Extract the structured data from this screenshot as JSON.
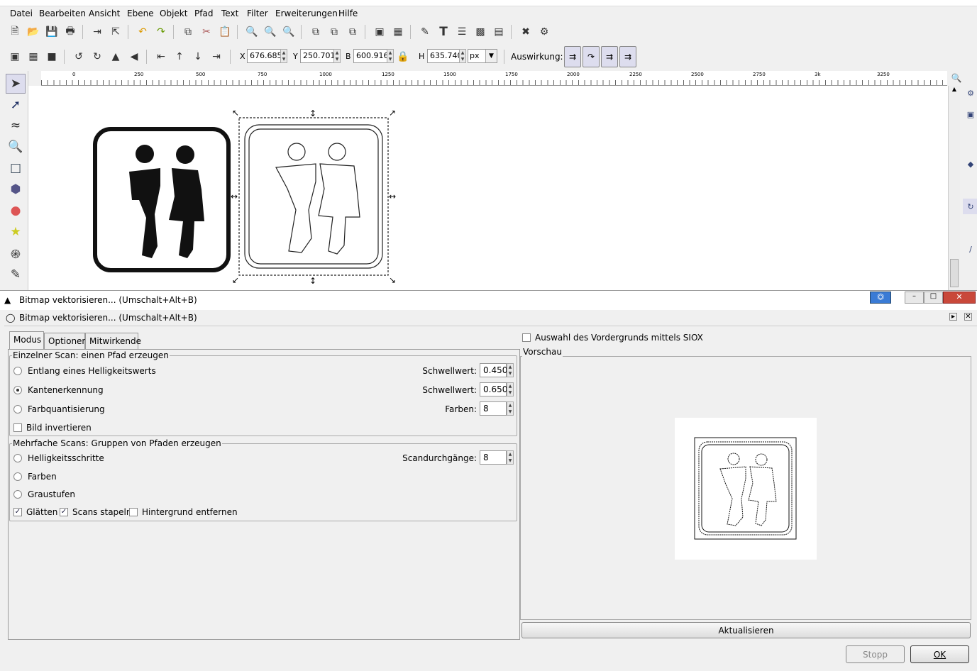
{
  "menu": [
    "Datei",
    "Bearbeiten",
    "Ansicht",
    "Ebene",
    "Objekt",
    "Pfad",
    "Text",
    "Filter",
    "Erweiterungen",
    "Hilfe"
  ],
  "toolbar2": {
    "x_label": "X",
    "x_value": "676.685",
    "y_label": "Y",
    "y_value": "250.701",
    "w_label": "B",
    "w_value": "600.916",
    "h_label": "H",
    "h_value": "635.740",
    "unit": "px",
    "effect_label": "Auswirkung:"
  },
  "ruler": {
    "h_ticks": [
      "0",
      "250",
      "500",
      "750",
      "1000",
      "1250",
      "1500",
      "1750",
      "2000",
      "2250",
      "2500",
      "2750",
      "3k",
      "3250"
    ],
    "v_ticks": [
      "1000",
      "750",
      "500",
      "250"
    ]
  },
  "dialog": {
    "window_title": "Bitmap vektorisieren... (Umschalt+Alt+B)",
    "dock_title": "Bitmap vektorisieren... (Umschalt+Alt+B)",
    "tabs": [
      "Modus",
      "Optionen",
      "Mitwirkende"
    ],
    "single_scan": {
      "legend": "Einzelner Scan: einen Pfad erzeugen",
      "brightness": "Entlang eines Helligkeitswerts",
      "brightness_threshold_label": "Schwellwert:",
      "brightness_threshold": "0.450",
      "edge": "Kantenerkennung",
      "edge_threshold_label": "Schwellwert:",
      "edge_threshold": "0.650",
      "color_quant": "Farbquantisierung",
      "colors_label": "Farben:",
      "colors": "8",
      "invert": "Bild invertieren"
    },
    "multi_scan": {
      "legend": "Mehrfache Scans: Gruppen von Pfaden erzeugen",
      "brightness_steps": "Helligkeitsschritte",
      "scans_label": "Scandurchgänge:",
      "scans": "8",
      "colors": "Farben",
      "gray": "Graustufen",
      "smooth": "Glätten",
      "stack": "Scans stapeln",
      "remove_bg": "Hintergrund entfernen"
    },
    "siox": "Auswahl des Vordergrunds mittels SIOX",
    "preview_label": "Vorschau",
    "update_button": "Aktualisieren",
    "stop_button": "Stopp",
    "ok_button": "OK"
  }
}
